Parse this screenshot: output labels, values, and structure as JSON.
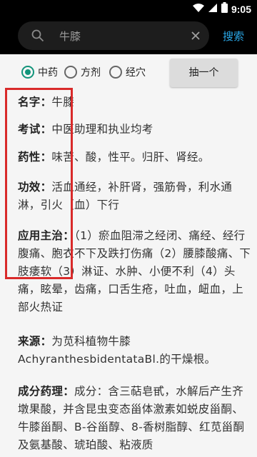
{
  "status": {
    "time": "9:05"
  },
  "search": {
    "query": "牛膝",
    "button": "搜索"
  },
  "filters": {
    "options": [
      {
        "label": "中药",
        "checked": true
      },
      {
        "label": "方剂",
        "checked": false
      },
      {
        "label": "经穴",
        "checked": false
      }
    ],
    "random_button": "抽一个"
  },
  "detail": {
    "name": {
      "label": "名字：",
      "value": "牛膝"
    },
    "exam": {
      "label": "考试：",
      "value": "中医助理和执业均考"
    },
    "nature": {
      "label": "药性：",
      "value": "味苦、酸，性平。归肝、肾经。"
    },
    "effect": {
      "label": "功效：",
      "value": "活血通经，补肝肾，强筋骨，利水通淋，引火（血）下行"
    },
    "indication": {
      "label": "应用主治：",
      "value": "（1）瘀血阻滞之经闭、痛经、经行腹痛、胞衣不下及跌打伤痛（2）腰膝酸痛、下肢痿软（3）淋证、水肿、小便不利（4）头痛，眩晕，齿痛，口舌生疮，吐血，衄血，上部火热证"
    },
    "source": {
      "label": "来源：",
      "value": "为苋科植物牛膝AchyranthesbidentataBl.的干燥根。"
    },
    "pharm": {
      "label": "成分药理：",
      "value": "成分：含三萜皂甙，水解后产生齐墩果酸，并含昆虫变态甾体激素如蜕皮甾酮、牛膝甾酮、B-谷甾醇、8-香树脂醇、红苋甾酮及氨基酸、琥珀酸、粘液质"
    }
  },
  "colors": {
    "accent": "#12947a",
    "link": "#2aa8e8",
    "highlight": "#d92a2a"
  }
}
